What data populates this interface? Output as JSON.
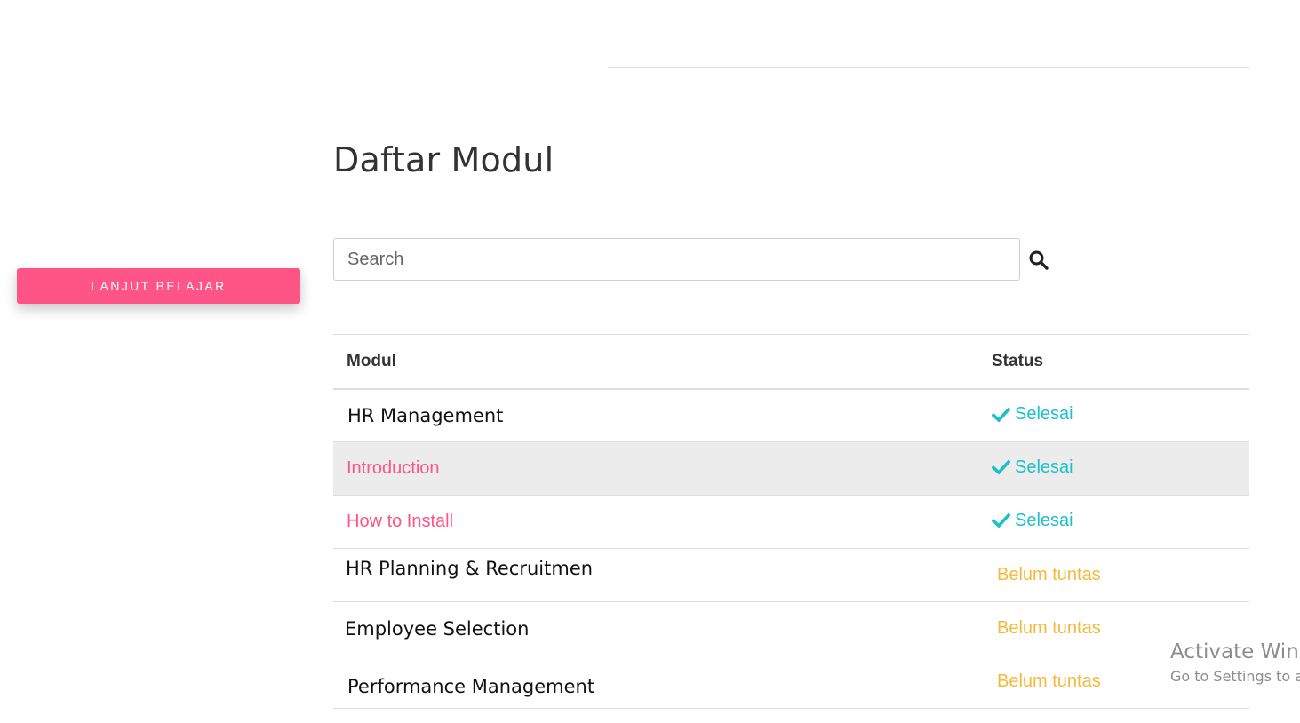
{
  "sidebar": {
    "continue_button": "LANJUT BELAJAR",
    "accent_color": "#ff5486"
  },
  "main": {
    "title": "Daftar Modul",
    "search": {
      "placeholder": "Search",
      "value": "",
      "icon": "search-icon"
    },
    "table": {
      "headers": {
        "module": "Modul",
        "status": "Status"
      },
      "rows": [
        {
          "name": "HR Management",
          "kind": "module",
          "status": "Selesai",
          "done": true
        },
        {
          "name": "Introduction",
          "kind": "lesson",
          "status": "Selesai",
          "done": true
        },
        {
          "name": "How to Install",
          "kind": "lesson",
          "status": "Selesai",
          "done": true
        },
        {
          "name": "HR Planning & Recruitmen",
          "kind": "module",
          "status": "Belum tuntas",
          "done": false
        },
        {
          "name": "Employee Selection",
          "kind": "module",
          "status": "Belum tuntas",
          "done": false
        },
        {
          "name": "Performance Management",
          "kind": "module",
          "status": "Belum tuntas",
          "done": false
        }
      ],
      "colors": {
        "done": "#1cc0c9",
        "pending": "#f4b93a",
        "link": "#ff5486",
        "highlight_row": "#ececec"
      }
    }
  },
  "watermark": {
    "line1": "Activate Windows",
    "line2": "Go to Settings to activate Windows."
  }
}
